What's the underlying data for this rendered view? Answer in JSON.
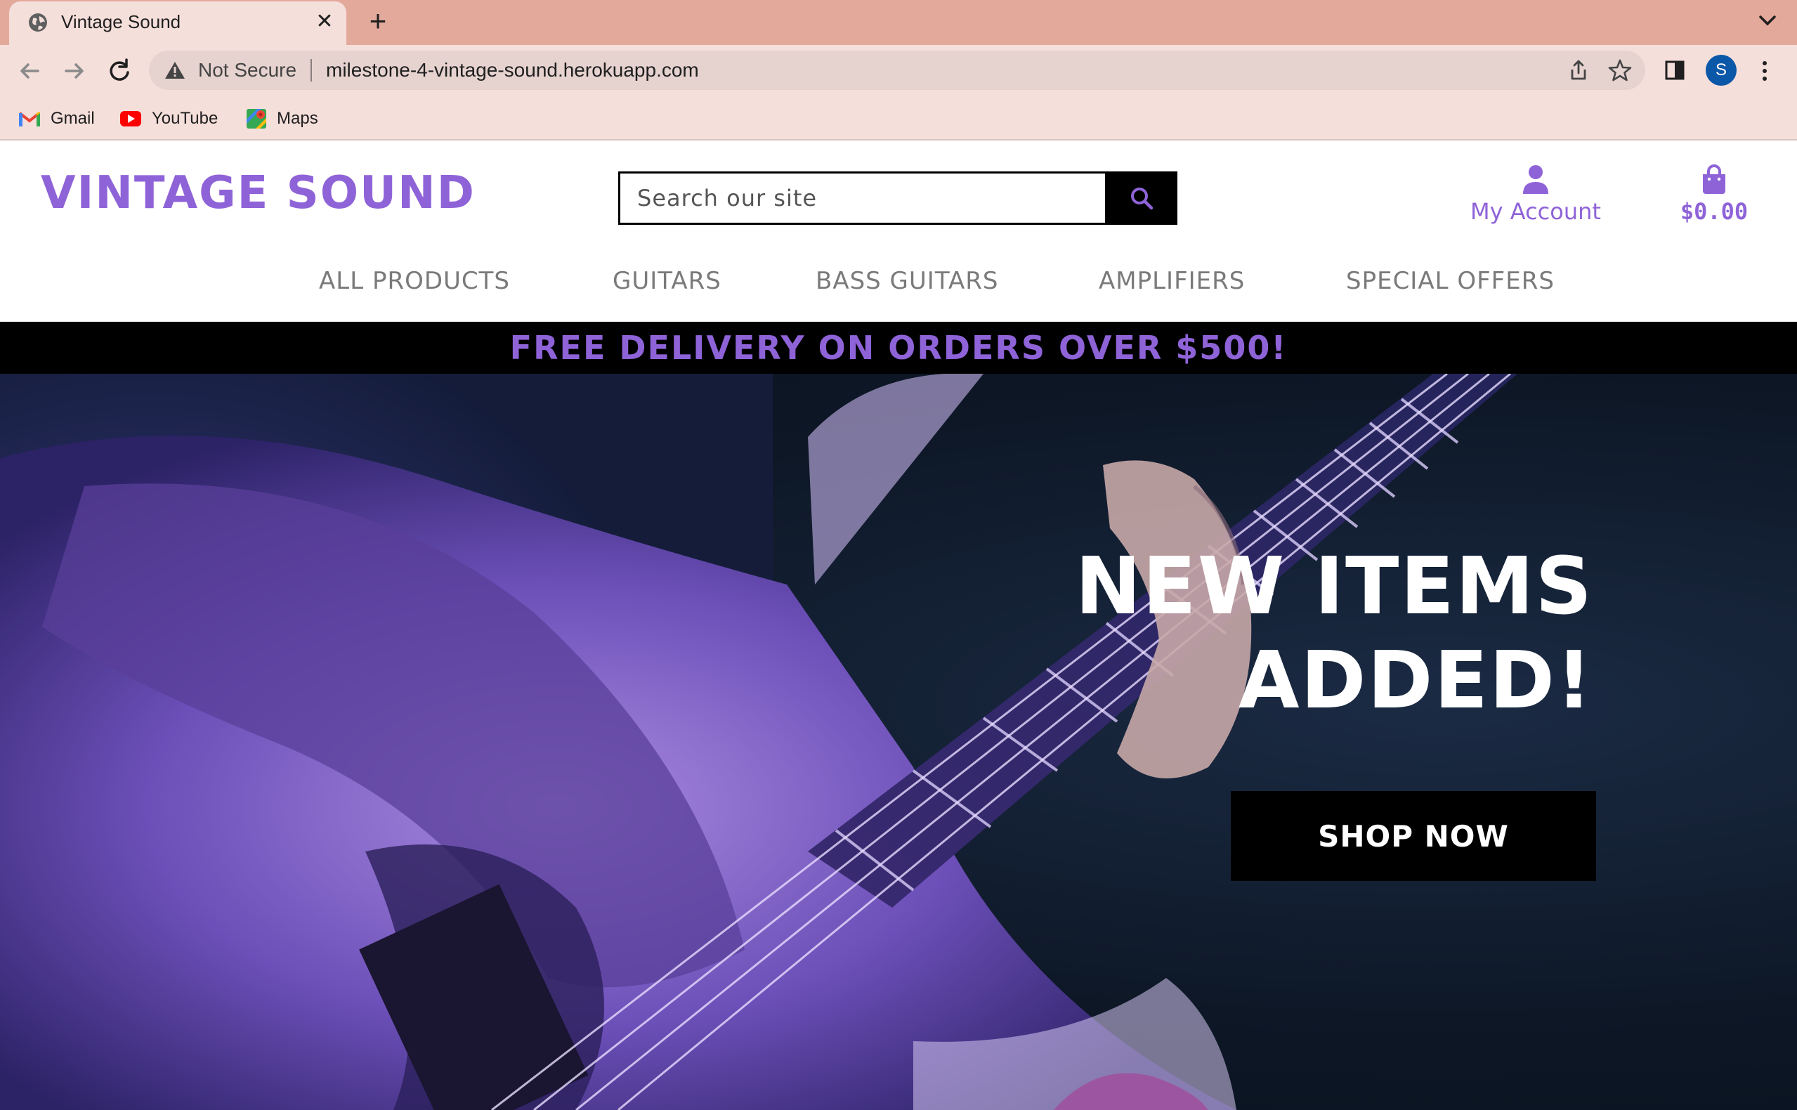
{
  "browser": {
    "tab_title": "Vintage Sound",
    "security_label": "Not Secure",
    "url": "milestone-4-vintage-sound.herokuapp.com",
    "profile_initial": "S",
    "bookmarks": [
      {
        "label": "Gmail",
        "icon": "gmail-icon"
      },
      {
        "label": "YouTube",
        "icon": "youtube-icon"
      },
      {
        "label": "Maps",
        "icon": "maps-icon"
      }
    ]
  },
  "site": {
    "brand": "VINTAGE SOUND",
    "search_placeholder": "Search our site",
    "account_label": "My Account",
    "cart_total": "$0.00",
    "nav": [
      "ALL PRODUCTS",
      "GUITARS",
      "BASS GUITARS",
      "AMPLIFIERS",
      "SPECIAL OFFERS"
    ],
    "promo": "FREE DELIVERY ON ORDERS OVER $500!",
    "hero_title_line1": "NEW ITEMS",
    "hero_title_line2": "ADDED!",
    "cta": "SHOP NOW"
  },
  "colors": {
    "brand_purple": "#8f63d8",
    "tab_strip": "#e3a99b",
    "toolbar": "#f5dfdb",
    "nav_gray": "#7a7a7a"
  }
}
